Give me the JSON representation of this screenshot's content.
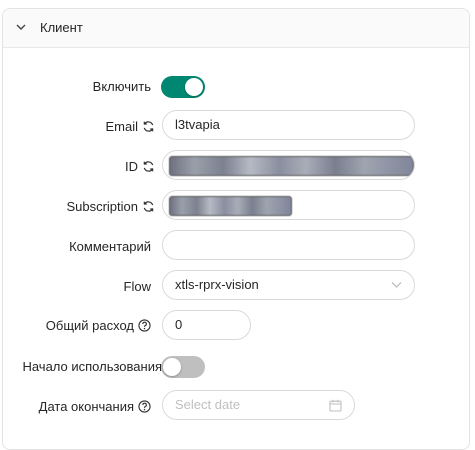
{
  "panel": {
    "title": "Клиент"
  },
  "form": {
    "enable": {
      "label": "Включить",
      "checked": true
    },
    "email": {
      "label": "Email",
      "value": "l3tvapia"
    },
    "id": {
      "label": "ID"
    },
    "subscription": {
      "label": "Subscription"
    },
    "comment": {
      "label": "Комментарий",
      "value": ""
    },
    "flow": {
      "label": "Flow",
      "value": "xtls-rprx-vision"
    },
    "total_usage": {
      "label": "Общий расход",
      "value": "0"
    },
    "start_on_use": {
      "label": "Начало использования",
      "checked": false
    },
    "expiry_date": {
      "label": "Дата окончания",
      "placeholder": "Select date"
    }
  },
  "colors": {
    "accent": "#008771",
    "toggle_off": "#bfbfbf",
    "border": "#d9d9d9"
  },
  "icons": [
    "chevron-down-icon",
    "sync-icon",
    "question-circle-icon",
    "calendar-icon"
  ]
}
